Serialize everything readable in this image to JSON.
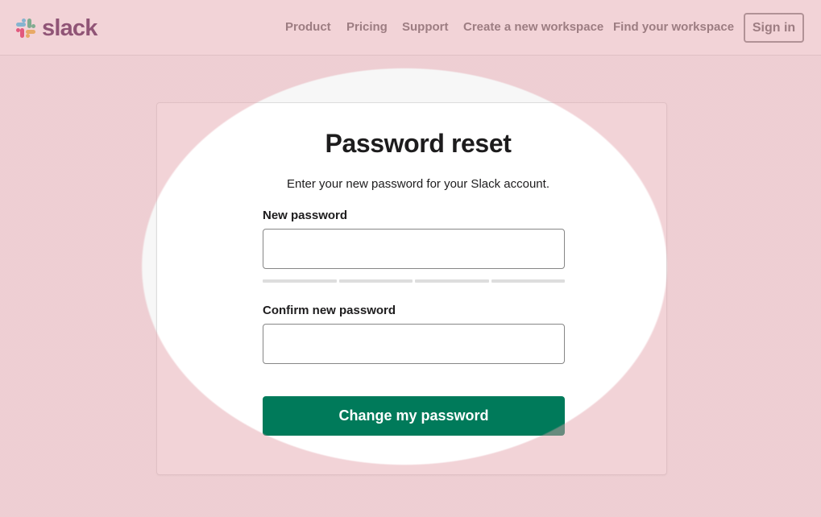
{
  "header": {
    "logo_text": "slack",
    "nav": {
      "product": "Product",
      "pricing": "Pricing",
      "support": "Support",
      "create_workspace": "Create a new workspace",
      "find_workspace": "Find your workspace"
    },
    "sign_in": "Sign in"
  },
  "form": {
    "title": "Password reset",
    "subtitle": "Enter your new password for your Slack account.",
    "new_password_label": "New password",
    "new_password_value": "",
    "confirm_password_label": "Confirm new password",
    "confirm_password_value": "",
    "strength_segments_filled": 0,
    "submit_label": "Change my password"
  },
  "colors": {
    "brand_aubergine": "#4a154b",
    "submit_green": "#007a5a",
    "highlight_overlay": "#e39fa8",
    "logo_blue": "#36c5f0",
    "logo_green": "#2eb67d",
    "logo_red": "#e01e5a",
    "logo_yellow": "#ecb22e"
  },
  "icons": {
    "logo": "slack-hash-logo-icon"
  }
}
